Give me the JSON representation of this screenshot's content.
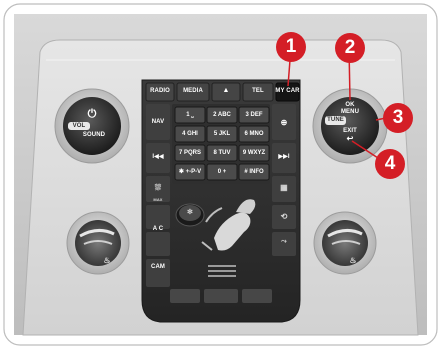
{
  "panel": {
    "top_buttons": [
      "RADIO",
      "MEDIA",
      "TEL",
      "MY CAR"
    ],
    "eject_symbol": "▲",
    "nav_label": "NAV",
    "skip_back": "I◀◀",
    "skip_forward": "▶▶I",
    "ac_label": "A C",
    "cam_label": "CAM",
    "max_label": "MAX",
    "auto_label": "AUTO"
  },
  "left_knob": {
    "power_symbol": "⏻",
    "vol_label": "VOL",
    "sound_label": "SOUND"
  },
  "right_knob": {
    "ok_label": "OK",
    "menu_label": "MENU",
    "tune_label": "TUNE",
    "exit_label": "EXIT",
    "back_symbol": "↩"
  },
  "keypad": {
    "rows": [
      [
        "1 ⎵",
        "2 ABC",
        "3 DEF"
      ],
      [
        "4 GHI",
        "5 JKL",
        "6 MNO"
      ],
      [
        "7 PQRS",
        "8 TUV",
        "9 WXYZ"
      ],
      [
        "✱ +-P-V",
        "0 +",
        "# INFO"
      ]
    ]
  },
  "callouts": [
    "1",
    "2",
    "3",
    "4"
  ],
  "colors": {
    "callout": "#d41e26",
    "panel_dark": "#2b2b2b",
    "frame": "#c9c9c9"
  },
  "icons": [
    "power-icon",
    "eject-icon",
    "globe-icon",
    "defrost-rear-icon",
    "defrost-front-icon",
    "recirc-icon",
    "seat-heat-icon",
    "fan-icon",
    "airflow-seat-icon"
  ]
}
